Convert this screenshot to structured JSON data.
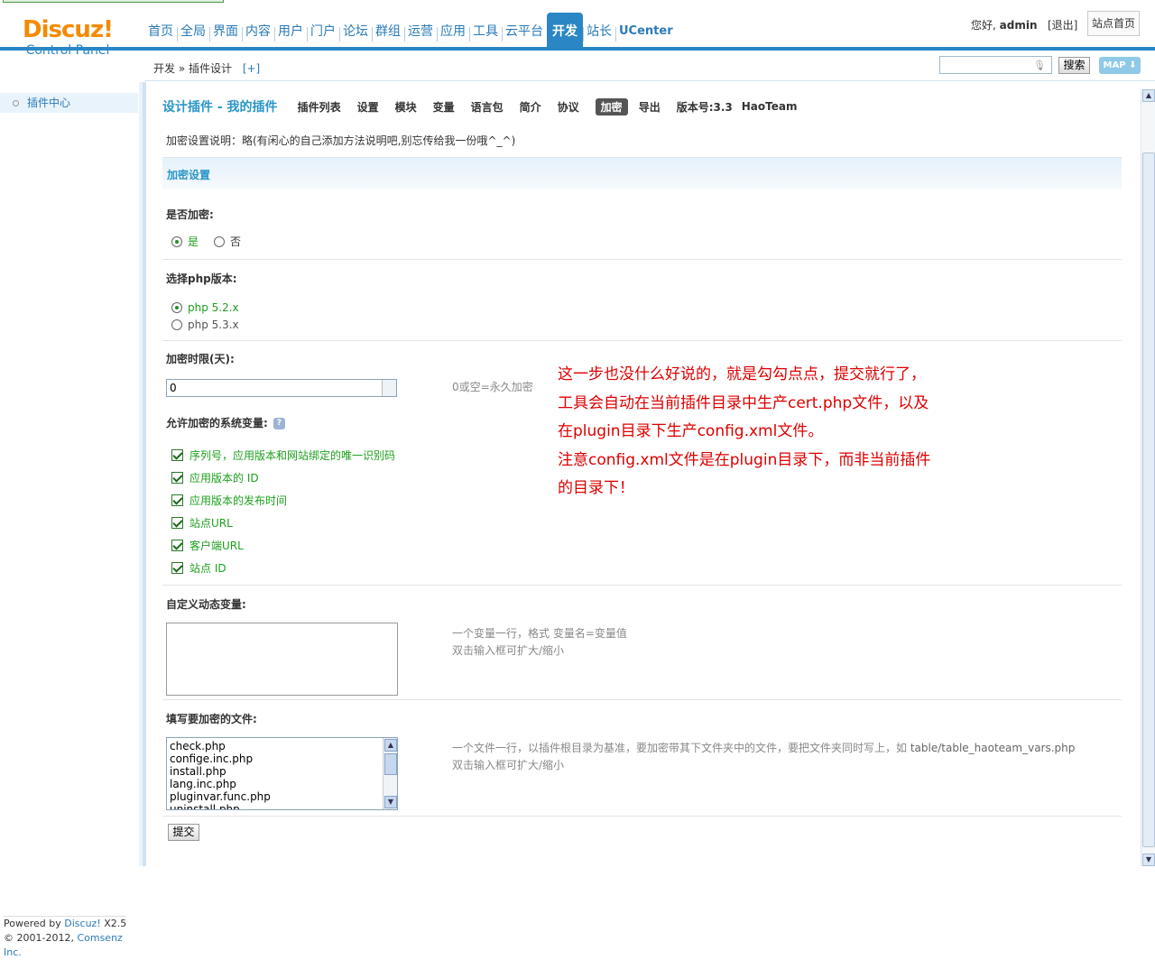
{
  "header": {
    "logo_brand": "Discuz!",
    "logo_sub": "Control Panel",
    "nav": [
      "首页",
      "全局",
      "界面",
      "内容",
      "用户",
      "门户",
      "论坛",
      "群组",
      "运营",
      "应用",
      "工具",
      "云平台",
      "开发",
      "站长",
      "UCenter"
    ],
    "active_nav": "开发",
    "greeting": "您好,",
    "username": "admin",
    "logout": "[退出]",
    "site_home": "站点首页"
  },
  "subbar": {
    "crumb": "开发 » 插件设计",
    "plus": "[+]",
    "search_value": "",
    "search_button": "搜索",
    "map_button": "MAP"
  },
  "sidebar": {
    "item": "插件中心",
    "powered_1a": "Powered by ",
    "powered_1b": "Discuz!",
    "powered_1c": " X2.5",
    "powered_2a": "© 2001-2012, ",
    "powered_2b": "Comsenz Inc."
  },
  "tabs": {
    "title": "设计插件 - 我的插件",
    "items": [
      "插件列表",
      "设置",
      "模块",
      "变量",
      "语言包",
      "简介",
      "协议",
      "加密",
      "导出"
    ],
    "active": "加密",
    "version": "版本号:3.3",
    "team": "HaoTeam"
  },
  "desc": "加密设置说明：略(有闲心的自己添加方法说明吧,别忘传给我一份哦^_^)",
  "section_title": "加密设置",
  "form": {
    "encrypt_label": "是否加密:",
    "encrypt_yes": "是",
    "encrypt_no": "否",
    "php_label": "选择php版本:",
    "php_opt1": "php 5.2.x",
    "php_opt2": "php 5.3.x",
    "limit_label": "加密时限(天):",
    "limit_value": "0",
    "limit_tip": "0或空=永久加密",
    "vars_label": "允许加密的系统变量:",
    "vars_help": "?",
    "vars": [
      "序列号，应用版本和网站绑定的唯一识别码",
      "应用版本的 ID",
      "应用版本的发布时间",
      "站点URL",
      "客户端URL",
      "站点 ID"
    ],
    "custom_label": "自定义动态变量:",
    "custom_tip1": "一个变量一行，格式 变量名=变量值",
    "custom_tip2": "双击输入框可扩大/缩小",
    "files_label": "填写要加密的文件:",
    "files": [
      "check.php",
      "confige.inc.php",
      "install.php",
      "lang.inc.php",
      "pluginvar.func.php",
      "uninstall.php"
    ],
    "files_tip1a": "一个文件一行，以插件根目录为基准，要加密带其下文件夹中的文件，要把文件夹同时写上，如 ",
    "files_tip1b": "table/table_haoteam_vars.php",
    "files_tip2": "双击输入框可扩大/缩小",
    "submit": "提交"
  },
  "annotation": [
    "这一步也没什么好说的，就是勾勾点点，提交就行了，",
    "工具会自动在当前插件目录中生产cert.php文件，以及",
    "在plugin目录下生产config.xml文件。",
    "注意config.xml文件是在plugin目录下，而非当前插件",
    "的目录下！"
  ],
  "colors": {
    "accent": "#2a86c4",
    "brand": "#f48a00",
    "annotation": "#dd0000",
    "checked": "#1ea01e"
  }
}
